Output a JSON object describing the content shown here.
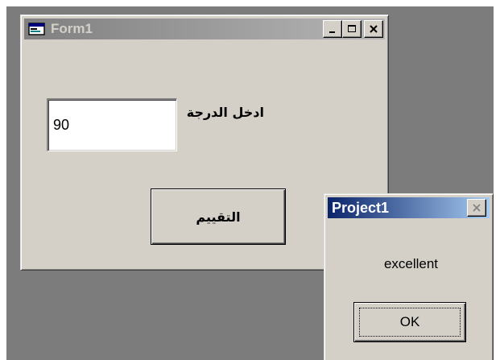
{
  "form": {
    "title": "Form1",
    "grade_label": "ادخل الدرجة",
    "grade_value": "90",
    "evaluate_button": "التقييم"
  },
  "msgbox": {
    "title": "Project1",
    "message": "excellent",
    "ok_label": "OK"
  },
  "icons": {
    "form_app": "vb-form-icon",
    "minimize": "minimize-icon",
    "maximize": "maximize-icon",
    "close": "close-icon"
  },
  "colors": {
    "desktop": "#7c7c7c",
    "window_face": "#d4d0c8",
    "inactive_title_start": "#808080",
    "inactive_title_end": "#b5b5b5",
    "active_title_start": "#0a246a",
    "active_title_end": "#a6caf0"
  }
}
